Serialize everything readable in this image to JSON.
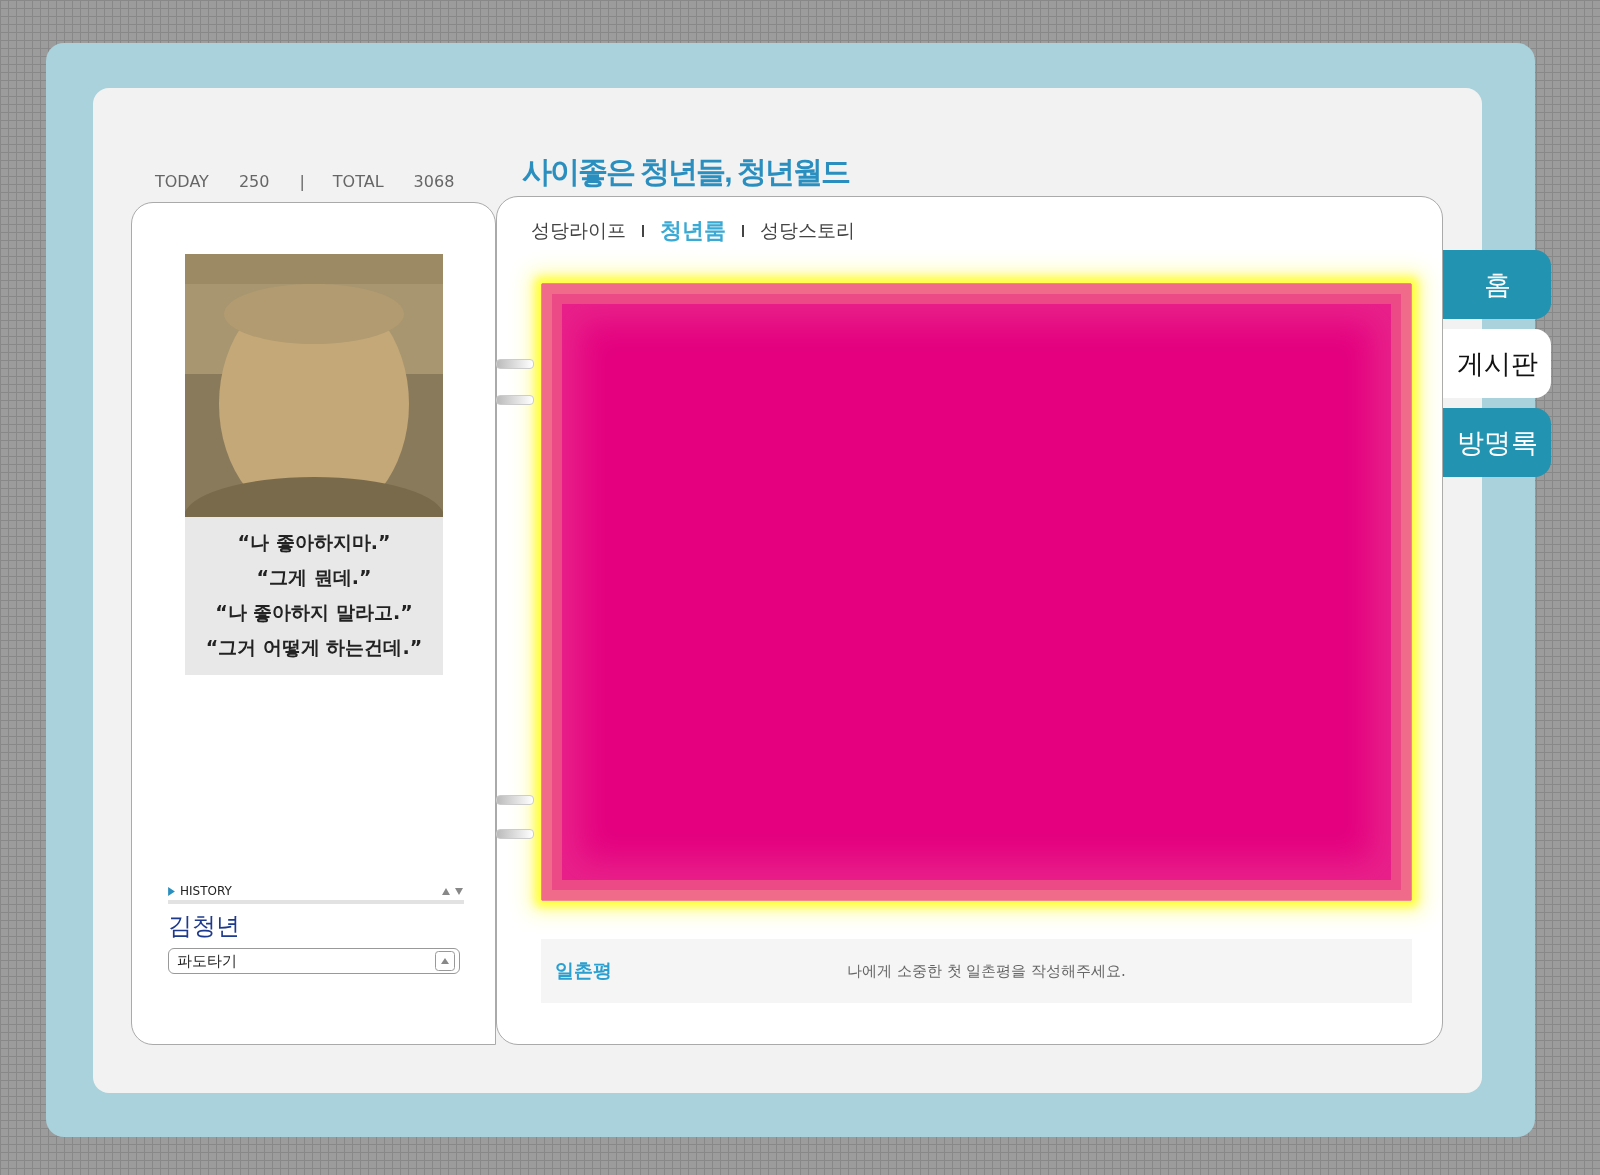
{
  "counter": {
    "today_label": "TODAY",
    "today": "250",
    "separator": "|",
    "total_label": "TOTAL",
    "total": "3068"
  },
  "profile": {
    "caption": [
      "“나 좋아하지마.”",
      "“그게 뭔데.”",
      "“나 좋아하지 말라고.”",
      "“그거 어떻게 하는건데.”"
    ],
    "history_label": "HISTORY",
    "name": "김청년",
    "select": "파도타기"
  },
  "title": "사이좋은 청년들, 청년월드",
  "nav": [
    {
      "label": "성당라이프",
      "selected": false
    },
    {
      "label": "청년룸",
      "selected": true
    },
    {
      "label": "성당스토리",
      "selected": false
    }
  ],
  "comment": {
    "label": "일촌평",
    "message": "나에게 소중한 첫 일촌평을 작성해주세요."
  },
  "tabs": [
    {
      "label": "홈",
      "selected": false
    },
    {
      "label": "게시판",
      "selected": true
    },
    {
      "label": "방명록",
      "selected": false
    }
  ]
}
